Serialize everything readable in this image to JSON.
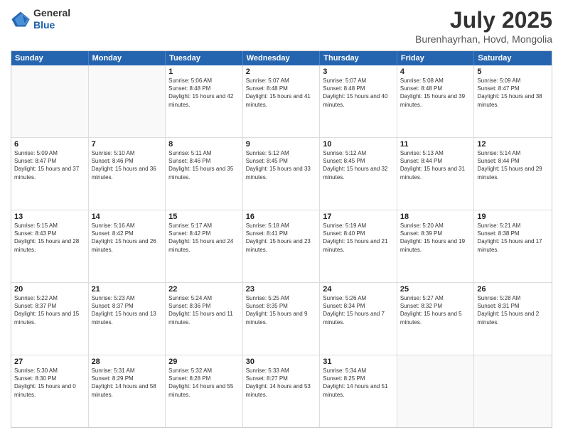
{
  "header": {
    "logo_general": "General",
    "logo_blue": "Blue",
    "title": "July 2025",
    "subtitle": "Burenhayrhan, Hovd, Mongolia"
  },
  "days_of_week": [
    "Sunday",
    "Monday",
    "Tuesday",
    "Wednesday",
    "Thursday",
    "Friday",
    "Saturday"
  ],
  "weeks": [
    [
      {
        "day": "",
        "info": ""
      },
      {
        "day": "",
        "info": ""
      },
      {
        "day": "1",
        "info": "Sunrise: 5:06 AM\nSunset: 8:48 PM\nDaylight: 15 hours and 42 minutes."
      },
      {
        "day": "2",
        "info": "Sunrise: 5:07 AM\nSunset: 8:48 PM\nDaylight: 15 hours and 41 minutes."
      },
      {
        "day": "3",
        "info": "Sunrise: 5:07 AM\nSunset: 8:48 PM\nDaylight: 15 hours and 40 minutes."
      },
      {
        "day": "4",
        "info": "Sunrise: 5:08 AM\nSunset: 8:48 PM\nDaylight: 15 hours and 39 minutes."
      },
      {
        "day": "5",
        "info": "Sunrise: 5:09 AM\nSunset: 8:47 PM\nDaylight: 15 hours and 38 minutes."
      }
    ],
    [
      {
        "day": "6",
        "info": "Sunrise: 5:09 AM\nSunset: 8:47 PM\nDaylight: 15 hours and 37 minutes."
      },
      {
        "day": "7",
        "info": "Sunrise: 5:10 AM\nSunset: 8:46 PM\nDaylight: 15 hours and 36 minutes."
      },
      {
        "day": "8",
        "info": "Sunrise: 5:11 AM\nSunset: 8:46 PM\nDaylight: 15 hours and 35 minutes."
      },
      {
        "day": "9",
        "info": "Sunrise: 5:12 AM\nSunset: 8:45 PM\nDaylight: 15 hours and 33 minutes."
      },
      {
        "day": "10",
        "info": "Sunrise: 5:12 AM\nSunset: 8:45 PM\nDaylight: 15 hours and 32 minutes."
      },
      {
        "day": "11",
        "info": "Sunrise: 5:13 AM\nSunset: 8:44 PM\nDaylight: 15 hours and 31 minutes."
      },
      {
        "day": "12",
        "info": "Sunrise: 5:14 AM\nSunset: 8:44 PM\nDaylight: 15 hours and 29 minutes."
      }
    ],
    [
      {
        "day": "13",
        "info": "Sunrise: 5:15 AM\nSunset: 8:43 PM\nDaylight: 15 hours and 28 minutes."
      },
      {
        "day": "14",
        "info": "Sunrise: 5:16 AM\nSunset: 8:42 PM\nDaylight: 15 hours and 26 minutes."
      },
      {
        "day": "15",
        "info": "Sunrise: 5:17 AM\nSunset: 8:42 PM\nDaylight: 15 hours and 24 minutes."
      },
      {
        "day": "16",
        "info": "Sunrise: 5:18 AM\nSunset: 8:41 PM\nDaylight: 15 hours and 23 minutes."
      },
      {
        "day": "17",
        "info": "Sunrise: 5:19 AM\nSunset: 8:40 PM\nDaylight: 15 hours and 21 minutes."
      },
      {
        "day": "18",
        "info": "Sunrise: 5:20 AM\nSunset: 8:39 PM\nDaylight: 15 hours and 19 minutes."
      },
      {
        "day": "19",
        "info": "Sunrise: 5:21 AM\nSunset: 8:38 PM\nDaylight: 15 hours and 17 minutes."
      }
    ],
    [
      {
        "day": "20",
        "info": "Sunrise: 5:22 AM\nSunset: 8:37 PM\nDaylight: 15 hours and 15 minutes."
      },
      {
        "day": "21",
        "info": "Sunrise: 5:23 AM\nSunset: 8:37 PM\nDaylight: 15 hours and 13 minutes."
      },
      {
        "day": "22",
        "info": "Sunrise: 5:24 AM\nSunset: 8:36 PM\nDaylight: 15 hours and 11 minutes."
      },
      {
        "day": "23",
        "info": "Sunrise: 5:25 AM\nSunset: 8:35 PM\nDaylight: 15 hours and 9 minutes."
      },
      {
        "day": "24",
        "info": "Sunrise: 5:26 AM\nSunset: 8:34 PM\nDaylight: 15 hours and 7 minutes."
      },
      {
        "day": "25",
        "info": "Sunrise: 5:27 AM\nSunset: 8:32 PM\nDaylight: 15 hours and 5 minutes."
      },
      {
        "day": "26",
        "info": "Sunrise: 5:28 AM\nSunset: 8:31 PM\nDaylight: 15 hours and 2 minutes."
      }
    ],
    [
      {
        "day": "27",
        "info": "Sunrise: 5:30 AM\nSunset: 8:30 PM\nDaylight: 15 hours and 0 minutes."
      },
      {
        "day": "28",
        "info": "Sunrise: 5:31 AM\nSunset: 8:29 PM\nDaylight: 14 hours and 58 minutes."
      },
      {
        "day": "29",
        "info": "Sunrise: 5:32 AM\nSunset: 8:28 PM\nDaylight: 14 hours and 55 minutes."
      },
      {
        "day": "30",
        "info": "Sunrise: 5:33 AM\nSunset: 8:27 PM\nDaylight: 14 hours and 53 minutes."
      },
      {
        "day": "31",
        "info": "Sunrise: 5:34 AM\nSunset: 8:25 PM\nDaylight: 14 hours and 51 minutes."
      },
      {
        "day": "",
        "info": ""
      },
      {
        "day": "",
        "info": ""
      }
    ]
  ]
}
